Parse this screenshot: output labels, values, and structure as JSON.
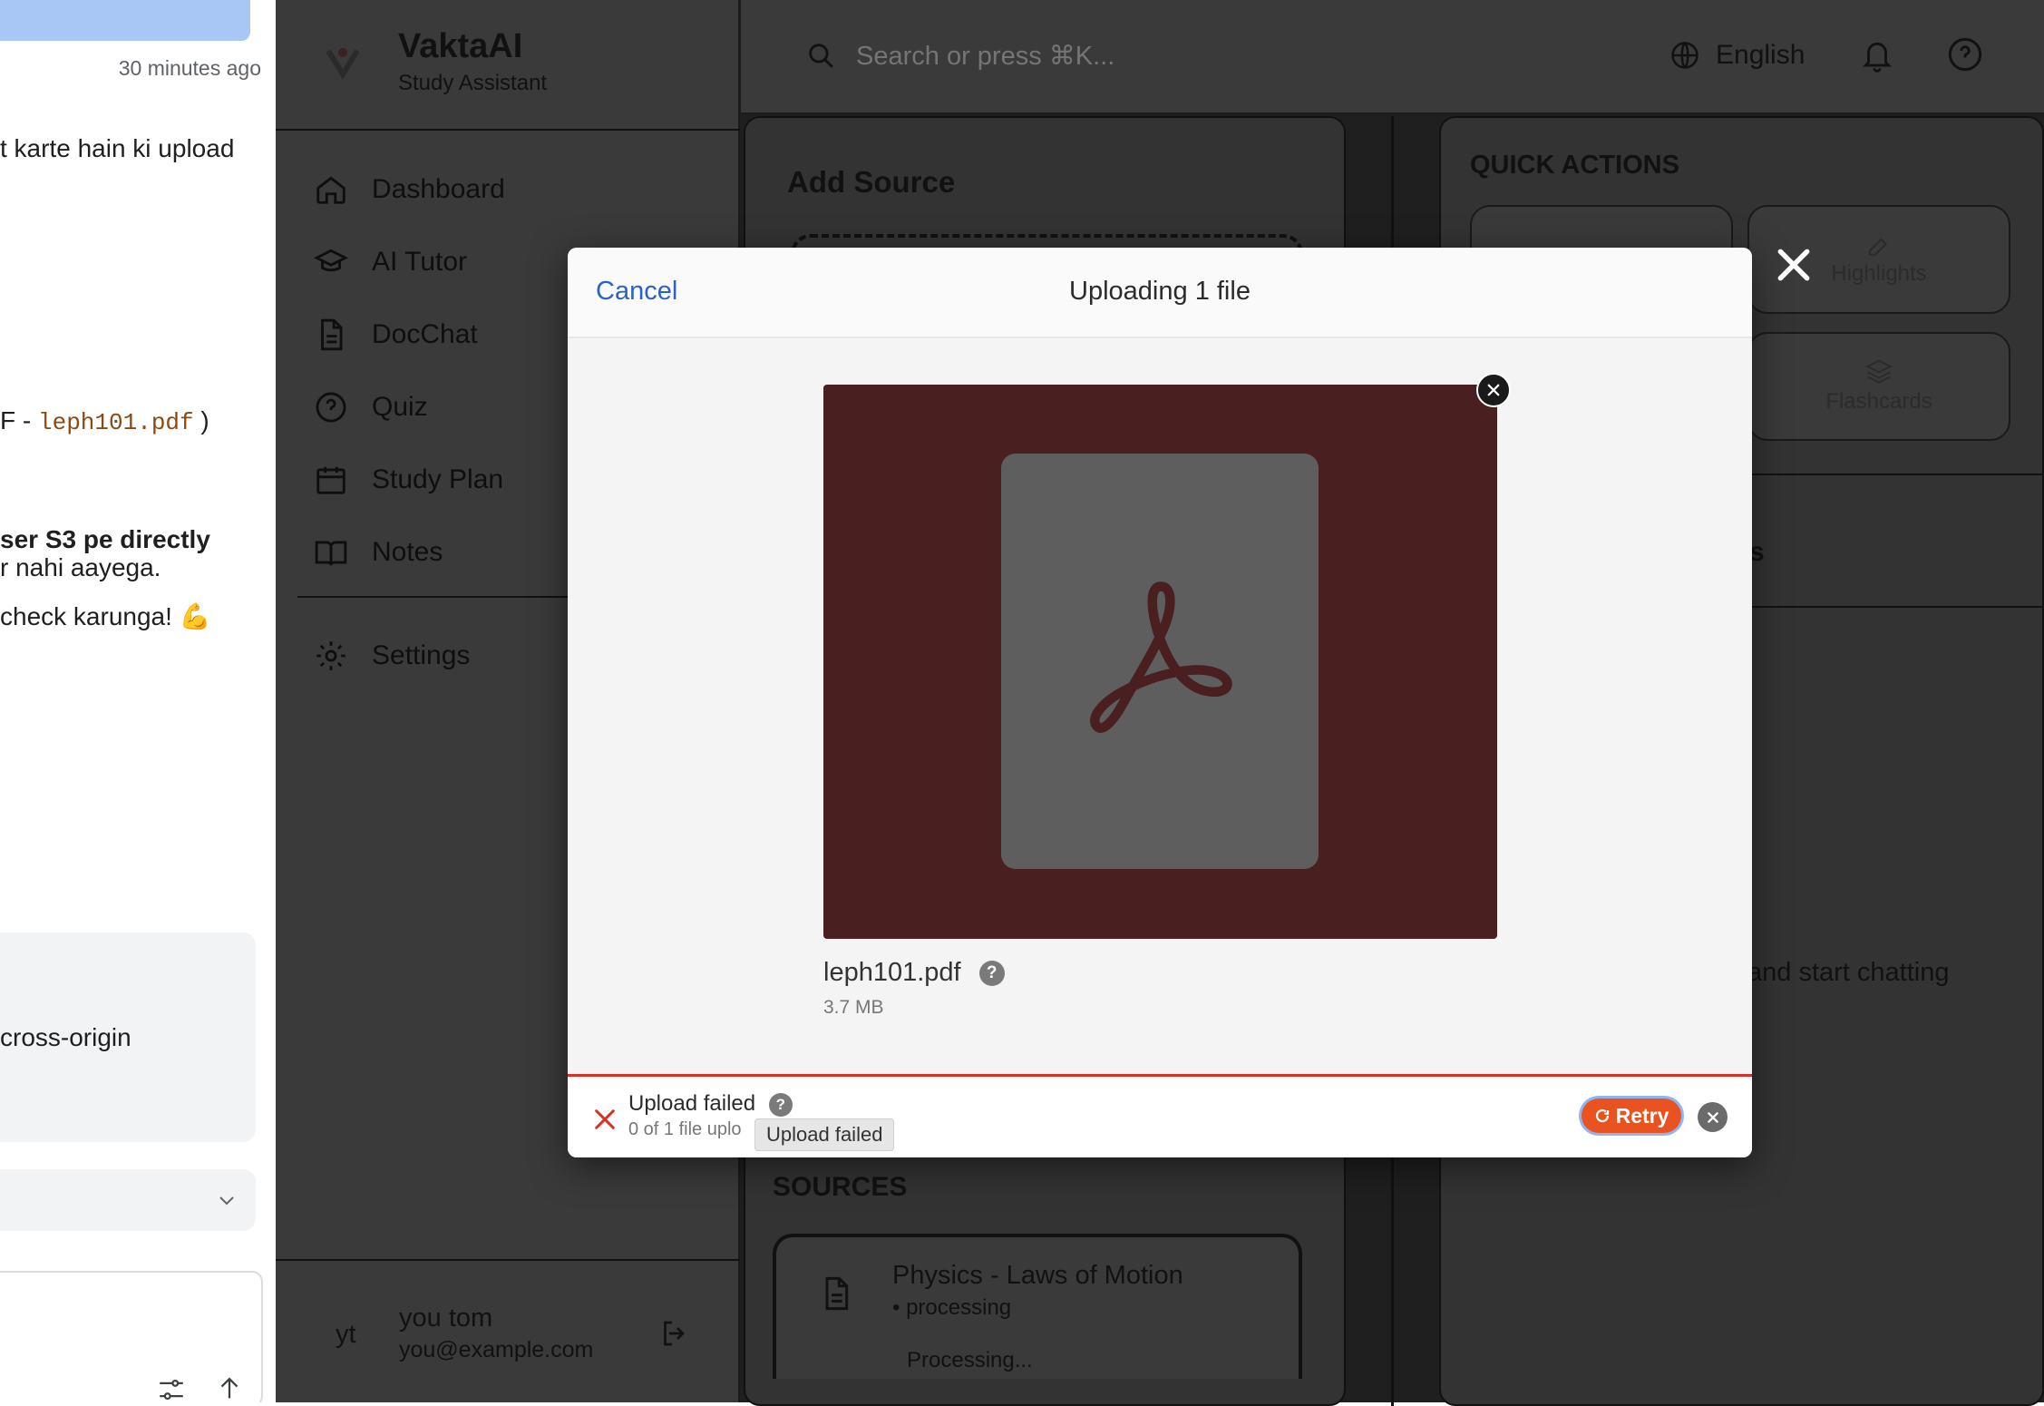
{
  "chat": {
    "timestamp": "30 minutes ago",
    "line1": "t karte hain ki upload",
    "line2_prefix": "F - ",
    "line2_code": "leph101.pdf",
    "line2_suffix": " )",
    "line3_bold": "ser S3 pe directly",
    "line4": "r nahi aayega.",
    "line5": " check karunga! 💪",
    "line6": "cross-origin"
  },
  "brand": {
    "name": "VaktaAI",
    "subtitle": "Study Assistant"
  },
  "nav": [
    {
      "label": "Dashboard",
      "icon": "home-icon"
    },
    {
      "label": "AI Tutor",
      "icon": "graduation-cap-icon"
    },
    {
      "label": "DocChat",
      "icon": "document-icon"
    },
    {
      "label": "Quiz",
      "icon": "question-circle-icon"
    },
    {
      "label": "Study Plan",
      "icon": "calendar-icon"
    },
    {
      "label": "Notes",
      "icon": "book-open-icon"
    },
    {
      "label": "Settings",
      "icon": "gear-icon"
    }
  ],
  "user": {
    "initials": "yt",
    "name": "you tom",
    "email": "you@example.com"
  },
  "topbar": {
    "search_placeholder": "Search or press ⌘K...",
    "language": "English"
  },
  "add_source": {
    "title": "Add Source"
  },
  "quick_actions": {
    "title": "QUICK ACTIONS",
    "highlights": "Highlights",
    "flashcards": "Flashcards"
  },
  "right_panel": {
    "section_fragment": "ts",
    "hint_fragment": "and start chatting"
  },
  "sources": {
    "title": "SOURCES",
    "item_title": "Physics - Laws of Motion",
    "item_status": "• processing",
    "item_progress": "Processing..."
  },
  "modal": {
    "cancel": "Cancel",
    "title": "Uploading 1 file",
    "file_name": "leph101.pdf",
    "file_size": "3.7 MB",
    "status": "Upload failed",
    "sub_status": "0 of 1 file uplo",
    "tooltip": "Upload failed",
    "retry": "Retry"
  },
  "colors": {
    "accent_blue": "#2a62c9",
    "error_red": "#d93025",
    "retry_orange": "#e8531f",
    "pdf_red": "#4a1f1f"
  }
}
